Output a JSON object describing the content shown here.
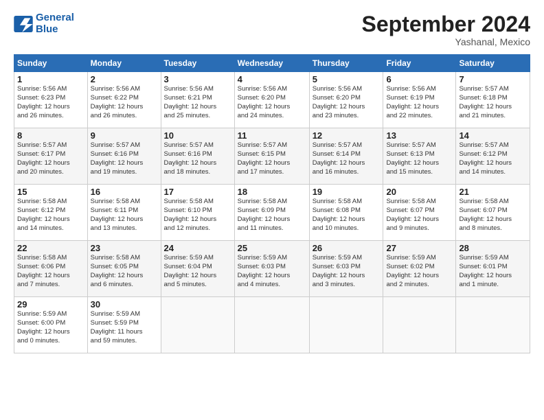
{
  "logo": {
    "line1": "General",
    "line2": "Blue"
  },
  "header": {
    "month": "September 2024",
    "location": "Yashanal, Mexico"
  },
  "weekdays": [
    "Sunday",
    "Monday",
    "Tuesday",
    "Wednesday",
    "Thursday",
    "Friday",
    "Saturday"
  ],
  "weeks": [
    [
      {
        "day": "1",
        "info": "Sunrise: 5:56 AM\nSunset: 6:23 PM\nDaylight: 12 hours\nand 26 minutes."
      },
      {
        "day": "2",
        "info": "Sunrise: 5:56 AM\nSunset: 6:22 PM\nDaylight: 12 hours\nand 26 minutes."
      },
      {
        "day": "3",
        "info": "Sunrise: 5:56 AM\nSunset: 6:21 PM\nDaylight: 12 hours\nand 25 minutes."
      },
      {
        "day": "4",
        "info": "Sunrise: 5:56 AM\nSunset: 6:20 PM\nDaylight: 12 hours\nand 24 minutes."
      },
      {
        "day": "5",
        "info": "Sunrise: 5:56 AM\nSunset: 6:20 PM\nDaylight: 12 hours\nand 23 minutes."
      },
      {
        "day": "6",
        "info": "Sunrise: 5:56 AM\nSunset: 6:19 PM\nDaylight: 12 hours\nand 22 minutes."
      },
      {
        "day": "7",
        "info": "Sunrise: 5:57 AM\nSunset: 6:18 PM\nDaylight: 12 hours\nand 21 minutes."
      }
    ],
    [
      {
        "day": "8",
        "info": "Sunrise: 5:57 AM\nSunset: 6:17 PM\nDaylight: 12 hours\nand 20 minutes."
      },
      {
        "day": "9",
        "info": "Sunrise: 5:57 AM\nSunset: 6:16 PM\nDaylight: 12 hours\nand 19 minutes."
      },
      {
        "day": "10",
        "info": "Sunrise: 5:57 AM\nSunset: 6:16 PM\nDaylight: 12 hours\nand 18 minutes."
      },
      {
        "day": "11",
        "info": "Sunrise: 5:57 AM\nSunset: 6:15 PM\nDaylight: 12 hours\nand 17 minutes."
      },
      {
        "day": "12",
        "info": "Sunrise: 5:57 AM\nSunset: 6:14 PM\nDaylight: 12 hours\nand 16 minutes."
      },
      {
        "day": "13",
        "info": "Sunrise: 5:57 AM\nSunset: 6:13 PM\nDaylight: 12 hours\nand 15 minutes."
      },
      {
        "day": "14",
        "info": "Sunrise: 5:57 AM\nSunset: 6:12 PM\nDaylight: 12 hours\nand 14 minutes."
      }
    ],
    [
      {
        "day": "15",
        "info": "Sunrise: 5:58 AM\nSunset: 6:12 PM\nDaylight: 12 hours\nand 14 minutes."
      },
      {
        "day": "16",
        "info": "Sunrise: 5:58 AM\nSunset: 6:11 PM\nDaylight: 12 hours\nand 13 minutes."
      },
      {
        "day": "17",
        "info": "Sunrise: 5:58 AM\nSunset: 6:10 PM\nDaylight: 12 hours\nand 12 minutes."
      },
      {
        "day": "18",
        "info": "Sunrise: 5:58 AM\nSunset: 6:09 PM\nDaylight: 12 hours\nand 11 minutes."
      },
      {
        "day": "19",
        "info": "Sunrise: 5:58 AM\nSunset: 6:08 PM\nDaylight: 12 hours\nand 10 minutes."
      },
      {
        "day": "20",
        "info": "Sunrise: 5:58 AM\nSunset: 6:07 PM\nDaylight: 12 hours\nand 9 minutes."
      },
      {
        "day": "21",
        "info": "Sunrise: 5:58 AM\nSunset: 6:07 PM\nDaylight: 12 hours\nand 8 minutes."
      }
    ],
    [
      {
        "day": "22",
        "info": "Sunrise: 5:58 AM\nSunset: 6:06 PM\nDaylight: 12 hours\nand 7 minutes."
      },
      {
        "day": "23",
        "info": "Sunrise: 5:58 AM\nSunset: 6:05 PM\nDaylight: 12 hours\nand 6 minutes."
      },
      {
        "day": "24",
        "info": "Sunrise: 5:59 AM\nSunset: 6:04 PM\nDaylight: 12 hours\nand 5 minutes."
      },
      {
        "day": "25",
        "info": "Sunrise: 5:59 AM\nSunset: 6:03 PM\nDaylight: 12 hours\nand 4 minutes."
      },
      {
        "day": "26",
        "info": "Sunrise: 5:59 AM\nSunset: 6:03 PM\nDaylight: 12 hours\nand 3 minutes."
      },
      {
        "day": "27",
        "info": "Sunrise: 5:59 AM\nSunset: 6:02 PM\nDaylight: 12 hours\nand 2 minutes."
      },
      {
        "day": "28",
        "info": "Sunrise: 5:59 AM\nSunset: 6:01 PM\nDaylight: 12 hours\nand 1 minute."
      }
    ],
    [
      {
        "day": "29",
        "info": "Sunrise: 5:59 AM\nSunset: 6:00 PM\nDaylight: 12 hours\nand 0 minutes."
      },
      {
        "day": "30",
        "info": "Sunrise: 5:59 AM\nSunset: 5:59 PM\nDaylight: 11 hours\nand 59 minutes."
      },
      {
        "day": "",
        "info": ""
      },
      {
        "day": "",
        "info": ""
      },
      {
        "day": "",
        "info": ""
      },
      {
        "day": "",
        "info": ""
      },
      {
        "day": "",
        "info": ""
      }
    ]
  ]
}
